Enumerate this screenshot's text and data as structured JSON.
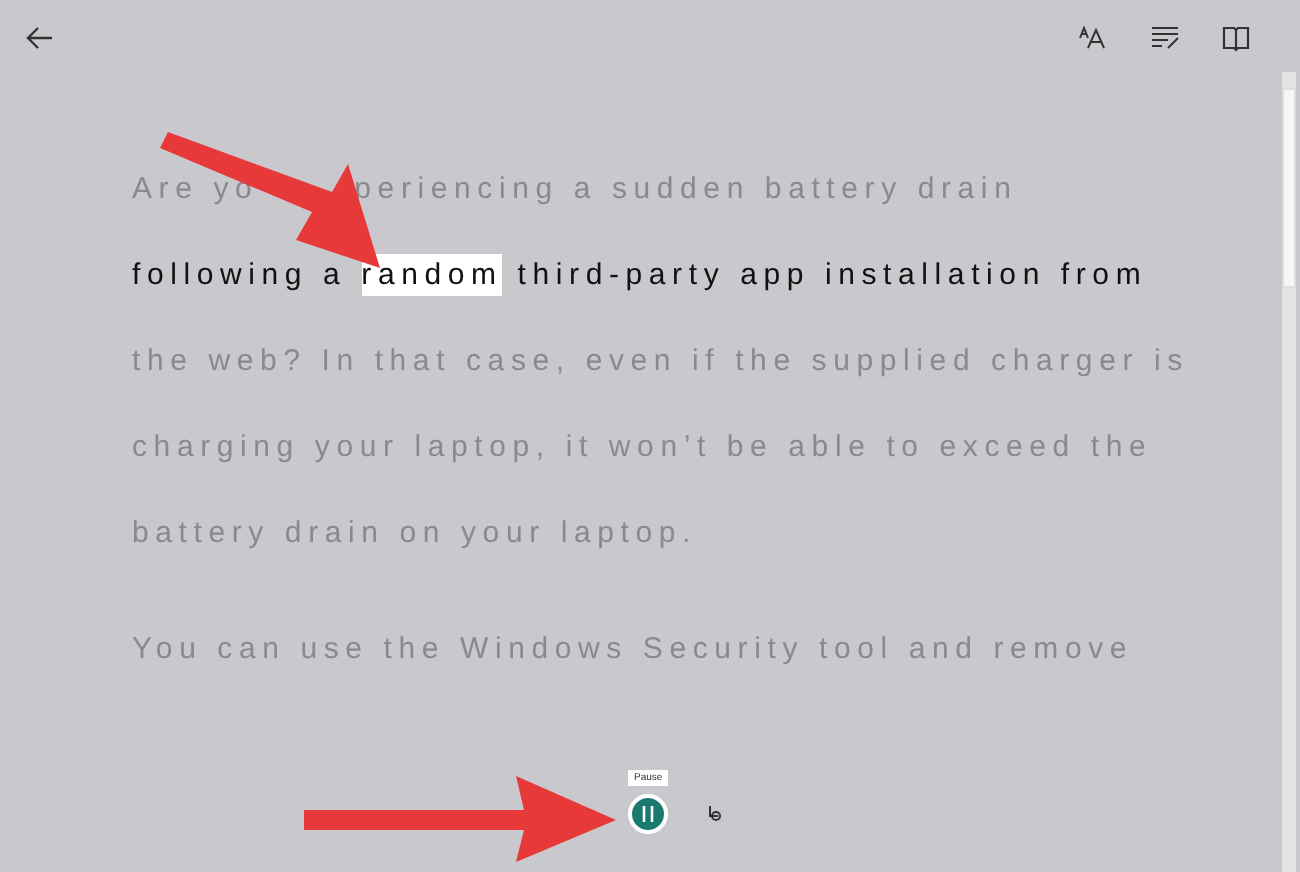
{
  "paragraphs": [
    {
      "lines": [
        {
          "active": false,
          "segments": [
            {
              "kind": "text",
              "text": "Are yo",
              "highlighted": false
            },
            {
              "kind": "covered"
            },
            {
              "kind": "text",
              "text": "periencing a sudden battery drain",
              "highlighted": false
            }
          ]
        },
        {
          "active": true,
          "segments": [
            {
              "text": "following a ",
              "highlighted": false
            },
            {
              "text": "random",
              "highlighted": true
            },
            {
              "text": " third-party app installation from",
              "highlighted": false
            }
          ]
        },
        {
          "active": false,
          "segments": [
            {
              "text": "the web? In that case, even if the supplied charger is",
              "highlighted": false
            }
          ]
        },
        {
          "active": false,
          "segments": [
            {
              "text": "charging your laptop, it won’t be able to exceed the",
              "highlighted": false
            }
          ]
        },
        {
          "active": false,
          "segments": [
            {
              "text": "battery drain on your laptop.",
              "highlighted": false
            }
          ]
        }
      ]
    },
    {
      "lines": [
        {
          "active": false,
          "segments": [
            {
              "text": "You can use the Windows Security tool and remove",
              "highlighted": false
            }
          ]
        }
      ]
    }
  ],
  "player": {
    "tooltip": "Pause",
    "playing": true
  }
}
